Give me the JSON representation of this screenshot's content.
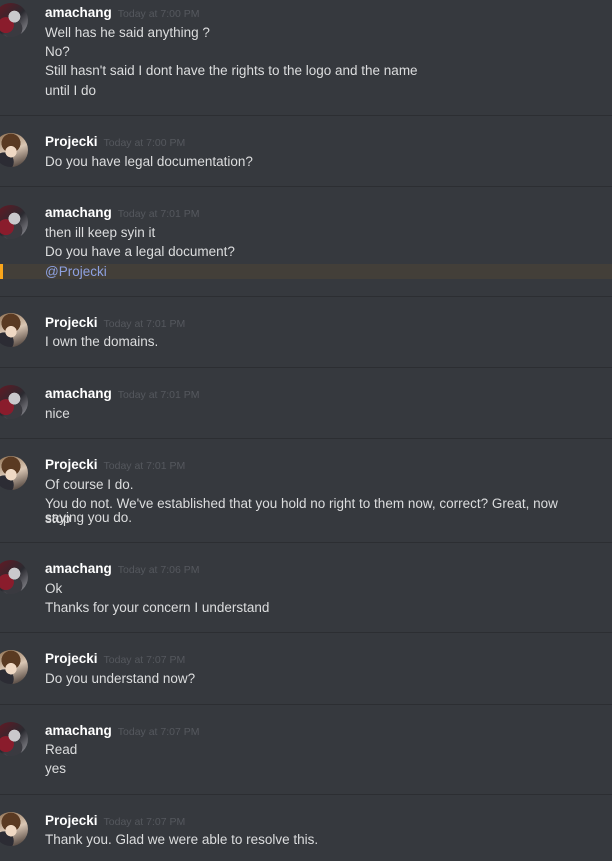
{
  "messages": [
    {
      "author": "amachang",
      "timestamp": "Today at 7:00 PM",
      "lines": [
        "Well has he said anything ?",
        "No?",
        "Still hasn't said I dont have the rights to the logo and the name",
        "until I do"
      ]
    },
    {
      "author": "Projecki",
      "timestamp": "Today at 7:00 PM",
      "lines": [
        "Do you have legal documentation?"
      ]
    },
    {
      "author": "amachang",
      "timestamp": "Today at 7:01 PM",
      "lines": [
        "then ill keep syin it",
        "Do you have a legal document?"
      ],
      "mention": "@Projecki"
    },
    {
      "author": "Projecki",
      "timestamp": "Today at 7:01 PM",
      "lines": [
        "I own the domains."
      ]
    },
    {
      "author": "amachang",
      "timestamp": "Today at 7:01 PM",
      "lines": [
        "nice"
      ]
    },
    {
      "author": "Projecki",
      "timestamp": "Today at 7:01 PM",
      "lines": [
        "Of course I do.",
        "You do not. We've established that you hold no right to them now, correct? Great, now stop",
        "saying you do."
      ]
    },
    {
      "author": "amachang",
      "timestamp": "Today at 7:06 PM",
      "lines": [
        "Ok",
        "Thanks for your concern I understand"
      ]
    },
    {
      "author": "Projecki",
      "timestamp": "Today at 7:07 PM",
      "lines": [
        "Do you understand now?"
      ]
    },
    {
      "author": "amachang",
      "timestamp": "Today at 7:07 PM",
      "lines": [
        "Read",
        "yes"
      ]
    },
    {
      "author": "Projecki",
      "timestamp": "Today at 7:07 PM",
      "lines": [
        "Thank you. Glad we were able to resolve this."
      ]
    }
  ]
}
